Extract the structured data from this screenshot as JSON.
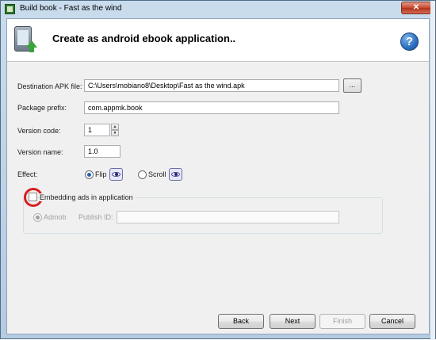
{
  "window": {
    "title": "Build book - Fast as the wind",
    "close_label": "✕"
  },
  "header": {
    "title": "Create as android ebook application..",
    "help_label": "?"
  },
  "form": {
    "destination_label": "Destination APK file:",
    "destination_value": "C:\\Users\\mobiano8\\Desktop\\Fast as the wind.apk",
    "browse_label": "...",
    "package_label": "Package prefix:",
    "package_value": "com.appmk.book",
    "version_code_label": "Version code:",
    "version_code_value": "1",
    "version_name_label": "Version name:",
    "version_name_value": "1.0",
    "effect_label": "Effect:",
    "effect_options": [
      {
        "label": "Flip",
        "selected": true
      },
      {
        "label": "Scroll",
        "selected": false
      }
    ]
  },
  "ads": {
    "checkbox_label": "Embedding ads in application",
    "checked": false,
    "provider_label": "Admob",
    "publish_id_label": "Publish ID:",
    "publish_id_value": ""
  },
  "buttons": {
    "back": "Back",
    "next": "Next",
    "finish": "Finish",
    "cancel": "Cancel"
  },
  "colors": {
    "annotation_circle": "#d81f1f",
    "help_icon": "#2b6fc0",
    "close_button": "#c6482f"
  }
}
